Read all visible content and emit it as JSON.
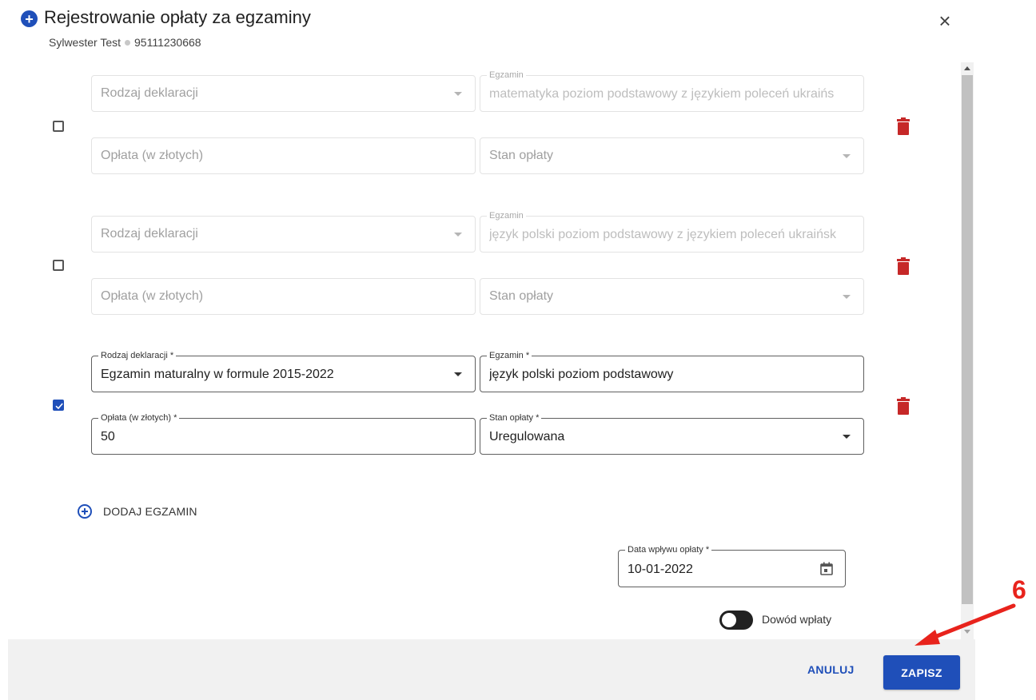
{
  "dialog": {
    "title": "Rejestrowanie opłaty za egzaminy",
    "subtitle_name": "Sylwester Test",
    "subtitle_id": "95111230668",
    "close_icon": "close-icon",
    "title_icon": "plus-circle-icon"
  },
  "rows": [
    {
      "checked": false,
      "rodzaj": {
        "label": "",
        "placeholder": "Rodzaj deklaracji",
        "value": ""
      },
      "egzamin": {
        "label": "Egzamin",
        "value": "matematyka poziom podstawowy z językiem poleceń ukraińs"
      },
      "oplata": {
        "label": "",
        "placeholder": "Opłata (w złotych)",
        "value": ""
      },
      "stan": {
        "label": "",
        "placeholder": "Stan opłaty",
        "value": ""
      }
    },
    {
      "checked": false,
      "rodzaj": {
        "label": "",
        "placeholder": "Rodzaj deklaracji",
        "value": ""
      },
      "egzamin": {
        "label": "Egzamin",
        "value": "język polski poziom podstawowy z językiem poleceń ukraińsk"
      },
      "oplata": {
        "label": "",
        "placeholder": "Opłata (w złotych)",
        "value": ""
      },
      "stan": {
        "label": "",
        "placeholder": "Stan opłaty",
        "value": ""
      }
    },
    {
      "checked": true,
      "rodzaj": {
        "label": "Rodzaj deklaracji *",
        "value": "Egzamin maturalny w formule 2015-2022"
      },
      "egzamin": {
        "label": "Egzamin *",
        "value": "język polski poziom podstawowy"
      },
      "oplata": {
        "label": "Opłata (w złotych) *",
        "value": "50"
      },
      "stan": {
        "label": "Stan opłaty *",
        "value": "Uregulowana"
      }
    }
  ],
  "add_exam_label": "DODAJ EGZAMIN",
  "date_field": {
    "label": "Data wpływu opłaty *",
    "value": "10-01-2022"
  },
  "toggle_label": "Dowód wpłaty",
  "footer": {
    "cancel_label": "ANULUJ",
    "save_label": "ZAPISZ"
  },
  "annotation": {
    "number": "6"
  },
  "colors": {
    "primary": "#1f4fb9",
    "trash": "#c62828",
    "annotation": "#e8231c"
  }
}
